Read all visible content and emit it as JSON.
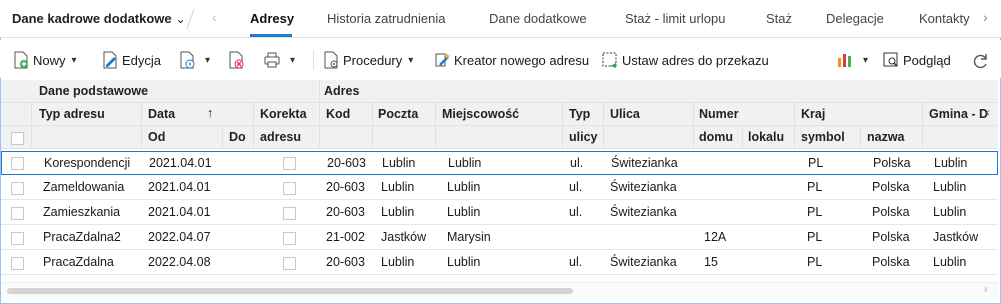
{
  "context_switcher": {
    "label": "Dane kadrowe dodatkowe",
    "chevron": "chevron-down-icon"
  },
  "tabs": [
    {
      "label": "Adresy",
      "active": true
    },
    {
      "label": "Historia zatrudnienia",
      "active": false
    },
    {
      "label": "Dane dodatkowe",
      "active": false
    },
    {
      "label": "Staż - limit urlopu",
      "active": false
    },
    {
      "label": "Staż",
      "active": false
    },
    {
      "label": "Delegacje",
      "active": false
    },
    {
      "label": "Kontakty",
      "active": false
    }
  ],
  "toolbar": {
    "new_label": "Nowy",
    "edit_label": "Edycja",
    "procedures_label": "Procedury",
    "wizard_label": "Kreator nowego adresu",
    "transfer_label": "Ustaw adres do przekazu",
    "preview_label": "Podgląd"
  },
  "colors": {
    "accent": "#1e7ad6",
    "header_bg": "#f1f1f1",
    "green_icon": "#3aa655",
    "red_icon": "#d9363e",
    "chart_orange": "#f28c28",
    "chart_red": "#e03a3a",
    "chart_green": "#49b04c"
  },
  "header": {
    "group_basic": "Dane podstawowe",
    "group_address": "Adres",
    "col_type": "Typ adresu",
    "col_date": "Data",
    "col_date_from": "Od",
    "col_date_to": "Do",
    "sort_arrow": "↑",
    "col_correction_1": "Korekta",
    "col_correction_2": "adresu",
    "col_code": "Kod",
    "col_post": "Poczta",
    "col_city": "Miejscowość",
    "col_street_type_1": "Typ",
    "col_street_type_2": "ulicy",
    "col_street": "Ulica",
    "col_number": "Numer",
    "col_house": "domu",
    "col_flat": "lokalu",
    "col_country": "Kraj",
    "col_country_symbol": "symbol",
    "col_country_name": "nazwa",
    "col_commune": "Gmina - D"
  },
  "rows": [
    {
      "type": "Korespondencji",
      "from": "2021.04.01",
      "to": "",
      "code": "20-603",
      "post": "Lublin",
      "city": "Lublin",
      "street_type": "ul.",
      "street": "Świtezianka",
      "house": "",
      "flat": "",
      "country_symbol": "PL",
      "country_name": "Polska",
      "commune": "Lublin"
    },
    {
      "type": "Zameldowania",
      "from": "2021.04.01",
      "to": "",
      "code": "20-603",
      "post": "Lublin",
      "city": "Lublin",
      "street_type": "ul.",
      "street": "Świtezianka",
      "house": "",
      "flat": "",
      "country_symbol": "PL",
      "country_name": "Polska",
      "commune": "Lublin"
    },
    {
      "type": "Zamieszkania",
      "from": "2021.04.01",
      "to": "",
      "code": "20-603",
      "post": "Lublin",
      "city": "Lublin",
      "street_type": "ul.",
      "street": "Świtezianka",
      "house": "",
      "flat": "",
      "country_symbol": "PL",
      "country_name": "Polska",
      "commune": "Lublin"
    },
    {
      "type": "PracaZdalna2",
      "from": "2022.04.07",
      "to": "",
      "code": "21-002",
      "post": "Jastków",
      "city": "Marysin",
      "street_type": "",
      "street": "",
      "house": "12A",
      "flat": "",
      "country_symbol": "PL",
      "country_name": "Polska",
      "commune": "Jastków"
    },
    {
      "type": "PracaZdalna",
      "from": "2022.04.08",
      "to": "",
      "code": "20-603",
      "post": "Lublin",
      "city": "Lublin",
      "street_type": "ul.",
      "street": "Świtezianka",
      "house": "15",
      "flat": "",
      "country_symbol": "PL",
      "country_name": "Polska",
      "commune": "Lublin"
    }
  ]
}
